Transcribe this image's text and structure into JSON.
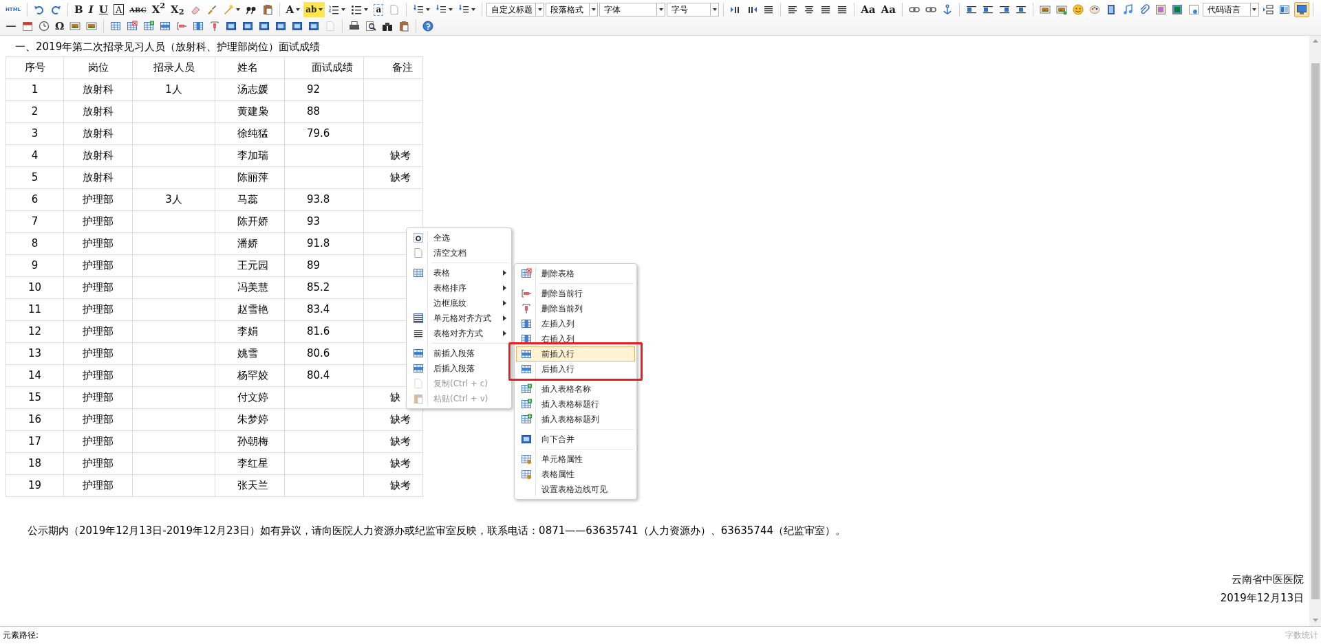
{
  "toolbar": {
    "rows": [
      [
        {
          "kind": "glyph",
          "label": "HTML"
        },
        {
          "kind": "separator"
        },
        {
          "kind": "icon"
        },
        {
          "kind": "icon"
        },
        {
          "kind": "separator"
        },
        {
          "kind": "glyph",
          "label": "B"
        },
        {
          "kind": "glyph",
          "label": "I"
        },
        {
          "kind": "glyph",
          "label": "U"
        },
        {
          "kind": "glyph",
          "label": "A"
        },
        {
          "kind": "glyph",
          "label": "ABC"
        },
        {
          "kind": "glyph",
          "label": "X$^{2}$"
        },
        {
          "kind": "glyph",
          "label": "X$_{2}$"
        },
        {
          "kind": "icon"
        },
        {
          "kind": "icon"
        },
        {
          "kind": "icon",
          "dropdown": true
        },
        {
          "kind": "icon"
        },
        {
          "kind": "icon"
        },
        {
          "kind": "separator"
        },
        {
          "kind": "glyph",
          "label": "A",
          "dropdown": true
        },
        {
          "kind": "glyph",
          "label": "ab",
          "dropdown": true
        },
        {
          "kind": "icon",
          "dropdown": true
        },
        {
          "kind": "icon",
          "dropdown": true
        },
        {
          "kind": "glyph",
          "label": "a"
        },
        {
          "kind": "icon"
        },
        {
          "kind": "separator"
        },
        {
          "kind": "icon",
          "dropdown": true
        },
        {
          "kind": "icon",
          "dropdown": true
        },
        {
          "kind": "icon",
          "dropdown": true
        },
        {
          "kind": "separator"
        },
        {
          "kind": "select",
          "label": "自定义标题"
        },
        {
          "kind": "select",
          "label": "段落格式"
        },
        {
          "kind": "select",
          "label": "字体"
        },
        {
          "kind": "select",
          "label": "字号"
        },
        {
          "kind": "separator"
        },
        {
          "kind": "icon"
        },
        {
          "kind": "icon"
        },
        {
          "kind": "icon"
        },
        {
          "kind": "separator"
        },
        {
          "kind": "icon"
        },
        {
          "kind": "icon"
        },
        {
          "kind": "icon"
        },
        {
          "kind": "icon"
        },
        {
          "kind": "separator"
        },
        {
          "kind": "glyph",
          "label": "Aa"
        },
        {
          "kind": "glyph",
          "label": "Aa"
        },
        {
          "kind": "separator"
        },
        {
          "kind": "icon"
        },
        {
          "kind": "icon"
        },
        {
          "kind": "icon"
        },
        {
          "kind": "separator"
        },
        {
          "kind": "icon"
        },
        {
          "kind": "icon"
        },
        {
          "kind": "icon"
        },
        {
          "kind": "icon"
        },
        {
          "kind": "separator"
        },
        {
          "kind": "icon"
        },
        {
          "kind": "icon"
        },
        {
          "kind": "icon"
        },
        {
          "kind": "icon"
        },
        {
          "kind": "icon"
        },
        {
          "kind": "icon"
        },
        {
          "kind": "icon"
        },
        {
          "kind": "icon"
        },
        {
          "kind": "icon"
        },
        {
          "kind": "icon"
        },
        {
          "kind": "select",
          "label": "代码语言"
        },
        {
          "kind": "icon"
        },
        {
          "kind": "icon"
        },
        {
          "kind": "icon"
        },
        {
          "kind": "separator"
        }
      ],
      [
        {
          "kind": "icon"
        },
        {
          "kind": "icon"
        },
        {
          "kind": "icon"
        },
        {
          "kind": "glyph",
          "label": "Ω"
        },
        {
          "kind": "icon"
        },
        {
          "kind": "icon"
        },
        {
          "kind": "separator"
        },
        {
          "kind": "icon"
        },
        {
          "kind": "icon"
        },
        {
          "kind": "icon"
        },
        {
          "kind": "icon"
        },
        {
          "kind": "icon"
        },
        {
          "kind": "icon"
        },
        {
          "kind": "icon"
        },
        {
          "kind": "icon"
        },
        {
          "kind": "icon"
        },
        {
          "kind": "icon"
        },
        {
          "kind": "icon"
        },
        {
          "kind": "icon"
        },
        {
          "kind": "icon"
        },
        {
          "kind": "icon"
        },
        {
          "kind": "separator"
        },
        {
          "kind": "icon"
        },
        {
          "kind": "icon"
        },
        {
          "kind": "icon"
        },
        {
          "kind": "icon"
        },
        {
          "kind": "separator"
        },
        {
          "kind": "icon"
        }
      ]
    ],
    "end_button": {
      "active": true
    }
  },
  "document": {
    "title": "一、2019年第二次招录见习人员（放射科、护理部岗位）面试成绩",
    "table": {
      "columns": [
        "序号",
        "岗位",
        "招录人员",
        "姓名",
        "面试成绩",
        "备注"
      ],
      "rows": [
        [
          "1",
          "放射科",
          "1人",
          "汤志媛",
          "92",
          null
        ],
        [
          "2",
          "放射科",
          null,
          "黄建枭",
          "88",
          null
        ],
        [
          "3",
          "放射科",
          null,
          "徐纯猛",
          "79.6",
          null
        ],
        [
          "4",
          "放射科",
          null,
          "李加瑞",
          null,
          "缺考"
        ],
        [
          "5",
          "放射科",
          null,
          "陈丽萍",
          null,
          "缺考"
        ],
        [
          "6",
          "护理部",
          "3人",
          "马蕊",
          "93.8",
          null
        ],
        [
          "7",
          "护理部",
          null,
          "陈开娇",
          "93",
          null
        ],
        [
          "8",
          "护理部",
          null,
          "潘娇",
          "91.8",
          null
        ],
        [
          "9",
          "护理部",
          null,
          "王元园",
          "89",
          null
        ],
        [
          "10",
          "护理部",
          null,
          "冯美慧",
          "85.2",
          null
        ],
        [
          "11",
          "护理部",
          null,
          "赵雪艳",
          "83.4",
          null
        ],
        [
          "12",
          "护理部",
          null,
          "李娟",
          "81.6",
          null
        ],
        [
          "13",
          "护理部",
          null,
          "姚雪",
          "80.6",
          null
        ],
        [
          "14",
          "护理部",
          null,
          "杨罕姣",
          "80.4",
          null
        ],
        [
          "15",
          "护理部",
          null,
          "付文婷",
          null,
          "缺"
        ],
        [
          "16",
          "护理部",
          null,
          "朱梦婷",
          null,
          "缺考"
        ],
        [
          "17",
          "护理部",
          null,
          "孙朝梅",
          null,
          "缺考"
        ],
        [
          "18",
          "护理部",
          null,
          "李红星",
          null,
          "缺考"
        ],
        [
          "19",
          "护理部",
          null,
          "张天兰",
          null,
          "缺考"
        ]
      ]
    },
    "notice": "公示期内（2019年12月13日-2019年12月23日）如有异议，请向医院人力资源办或纪监审室反映，联系电话：0871——63635741（人力资源办）、63635744（纪监审室）。",
    "signature": "云南省中医医院",
    "date": "2019年12月13日"
  },
  "context_menu": {
    "items": [
      {
        "kind": "item",
        "label": "全选",
        "has_submenu": false,
        "disabled": false
      },
      {
        "kind": "item",
        "label": "清空文档",
        "has_submenu": false,
        "disabled": false
      },
      {
        "kind": "separator"
      },
      {
        "kind": "item",
        "label": "表格",
        "has_submenu": true,
        "disabled": false
      },
      {
        "kind": "item",
        "label": "表格排序",
        "has_submenu": true,
        "disabled": false
      },
      {
        "kind": "item",
        "label": "边框底纹",
        "has_submenu": true,
        "disabled": false
      },
      {
        "kind": "item",
        "label": "单元格对齐方式",
        "has_submenu": true,
        "disabled": false
      },
      {
        "kind": "item",
        "label": "表格对齐方式",
        "has_submenu": true,
        "disabled": false
      },
      {
        "kind": "separator"
      },
      {
        "kind": "item",
        "label": "前插入段落",
        "has_submenu": false,
        "disabled": false
      },
      {
        "kind": "item",
        "label": "后插入段落",
        "has_submenu": false,
        "disabled": false
      },
      {
        "kind": "item",
        "label": "复制(Ctrl + c)",
        "has_submenu": false,
        "disabled": true
      },
      {
        "kind": "item",
        "label": "粘贴(Ctrl + v)",
        "has_submenu": false,
        "disabled": true
      }
    ],
    "submenu": {
      "items": [
        {
          "kind": "item",
          "label": "删除表格",
          "hovered": false,
          "outlined": false
        },
        {
          "kind": "separator"
        },
        {
          "kind": "item",
          "label": "删除当前行",
          "hovered": false,
          "outlined": false
        },
        {
          "kind": "item",
          "label": "删除当前列",
          "hovered": false,
          "outlined": false
        },
        {
          "kind": "item",
          "label": "左插入列",
          "hovered": false,
          "outlined": false
        },
        {
          "kind": "item",
          "label": "右插入列",
          "hovered": false,
          "outlined": false
        },
        {
          "kind": "item",
          "label": "前插入行",
          "hovered": true,
          "outlined": true
        },
        {
          "kind": "item",
          "label": "后插入行",
          "hovered": false,
          "outlined": true
        },
        {
          "kind": "separator"
        },
        {
          "kind": "item",
          "label": "插入表格名称",
          "hovered": false,
          "outlined": false
        },
        {
          "kind": "item",
          "label": "插入表格标题行",
          "hovered": false,
          "outlined": false
        },
        {
          "kind": "item",
          "label": "插入表格标题列",
          "hovered": false,
          "outlined": false
        },
        {
          "kind": "separator"
        },
        {
          "kind": "item",
          "label": "向下合并",
          "hovered": false,
          "outlined": false
        },
        {
          "kind": "separator"
        },
        {
          "kind": "item",
          "label": "单元格属性",
          "hovered": false,
          "outlined": false
        },
        {
          "kind": "item",
          "label": "表格属性",
          "hovered": false,
          "outlined": false
        },
        {
          "kind": "item",
          "label": "设置表格边线可见",
          "hovered": false,
          "outlined": false
        }
      ]
    }
  },
  "status_bar": {
    "path_label": "元素路径:",
    "word_count": "字数统计"
  }
}
